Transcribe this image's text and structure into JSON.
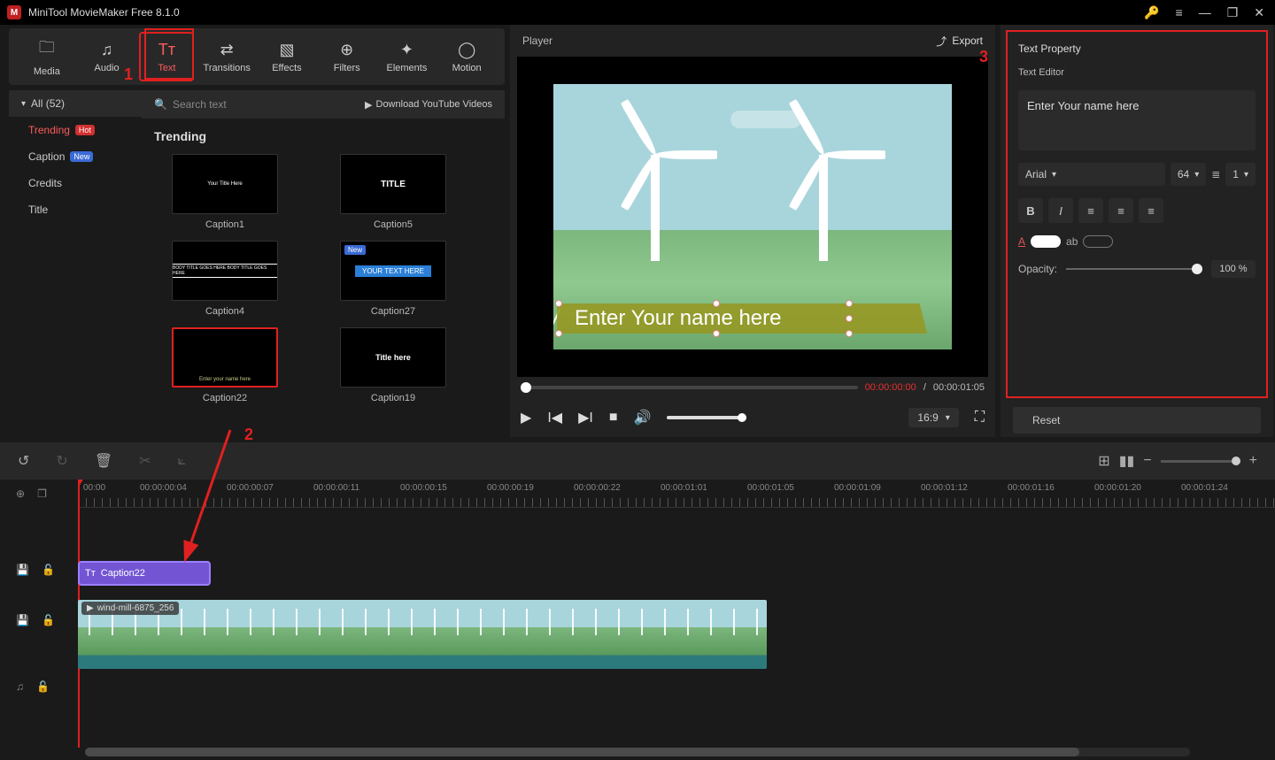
{
  "titlebar": {
    "app_title": "MiniTool MovieMaker Free 8.1.0"
  },
  "top_tabs": {
    "items": [
      {
        "label": "Media",
        "icon": "🗀"
      },
      {
        "label": "Audio",
        "icon": "♫"
      },
      {
        "label": "Text",
        "icon": "Tᴛ"
      },
      {
        "label": "Transitions",
        "icon": "⇄"
      },
      {
        "label": "Effects",
        "icon": "▧"
      },
      {
        "label": "Filters",
        "icon": "⊕"
      },
      {
        "label": "Elements",
        "icon": "✦"
      },
      {
        "label": "Motion",
        "icon": "◯"
      }
    ],
    "active_index": 2
  },
  "sidebar": {
    "all_label": "All (52)",
    "items": [
      {
        "label": "Trending",
        "badge": "Hot",
        "badge_class": "badge-hot"
      },
      {
        "label": "Caption",
        "badge": "New",
        "badge_class": "badge-new"
      },
      {
        "label": "Credits"
      },
      {
        "label": "Title"
      }
    ],
    "active_index": 0
  },
  "browser": {
    "search_placeholder": "Search text",
    "download_label": "Download YouTube Videos",
    "section_title": "Trending",
    "thumbs": [
      {
        "label": "Caption1",
        "inner": "Your  Title  Here"
      },
      {
        "label": "Caption5",
        "inner": "TITLE"
      },
      {
        "label": "Caption4",
        "inner": "BODY TITLE GOES HERE BODY TITLE GOES HERE"
      },
      {
        "label": "Caption27",
        "inner": "YOUR TEXT HERE",
        "new_badge": "New"
      },
      {
        "label": "Caption22",
        "inner": "Enter your name here",
        "selected": true
      },
      {
        "label": "Caption19",
        "inner": "Title here"
      }
    ]
  },
  "player": {
    "title": "Player",
    "export_label": "Export",
    "overlay_text": "Enter Your name here",
    "time_current": "00:00:00:00",
    "time_sep": " / ",
    "time_total": "00:00:01:05",
    "aspect": "16:9"
  },
  "right": {
    "panel_title": "Text Property",
    "editor_label": "Text Editor",
    "text_value": "Enter Your name here",
    "font": "Arial",
    "size": "64",
    "line_spacing": "1",
    "opacity_label": "Opacity:",
    "opacity_value": "100 %",
    "reset_label": "Reset"
  },
  "timeline": {
    "ruler": [
      "00:00",
      "00:00:00:04",
      "00:00:00:07",
      "00:00:00:11",
      "00:00:00:15",
      "00:00:00:19",
      "00:00:00:22",
      "00:00:01:01",
      "00:00:01:05",
      "00:00:01:09",
      "00:00:01:12",
      "00:00:01:16",
      "00:00:01:20",
      "00:00:01:24"
    ],
    "text_clip_label": "Caption22",
    "video_clip_label": "wind-mill-6875_256"
  },
  "annotations": {
    "n1": "1",
    "n2": "2",
    "n3": "3"
  }
}
